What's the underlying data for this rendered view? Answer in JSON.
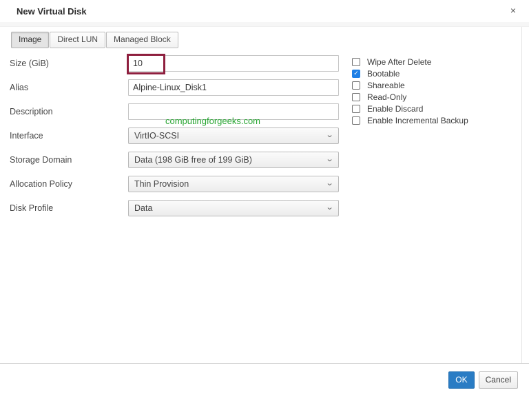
{
  "dialog": {
    "title": "New Virtual Disk",
    "close_icon": "×"
  },
  "tabs": [
    {
      "label": "Image",
      "active": true
    },
    {
      "label": "Direct LUN",
      "active": false
    },
    {
      "label": "Managed Block",
      "active": false
    }
  ],
  "form": {
    "fields": [
      {
        "label": "Size (GiB)",
        "type": "text",
        "value": "10",
        "highlighted": true
      },
      {
        "label": "Alias",
        "type": "text",
        "value": "Alpine-Linux_Disk1",
        "highlighted": false
      },
      {
        "label": "Description",
        "type": "text",
        "value": "",
        "highlighted": false
      },
      {
        "label": "Interface",
        "type": "select",
        "value": "VirtIO-SCSI"
      },
      {
        "label": "Storage Domain",
        "type": "select",
        "value": "Data (198 GiB free of 199 GiB)"
      },
      {
        "label": "Allocation Policy",
        "type": "select",
        "value": "Thin Provision"
      },
      {
        "label": "Disk Profile",
        "type": "select",
        "value": "Data"
      }
    ]
  },
  "checkboxes": [
    {
      "label": "Wipe After Delete",
      "checked": false
    },
    {
      "label": "Bootable",
      "checked": true
    },
    {
      "label": "Shareable",
      "checked": false
    },
    {
      "label": "Read-Only",
      "checked": false
    },
    {
      "label": "Enable Discard",
      "checked": false
    },
    {
      "label": "Enable Incremental Backup",
      "checked": false
    }
  ],
  "watermark": "computingforgeeks.com",
  "footer": {
    "ok_label": "OK",
    "cancel_label": "Cancel"
  },
  "icons": {
    "chevron_down": "⌄",
    "checkmark": "✓"
  },
  "colors": {
    "ok-blue": "#2a7cc4",
    "check-blue": "#1e7fe6",
    "highlight-red": "#8e1f3e",
    "watermark-green": "#28a532"
  }
}
